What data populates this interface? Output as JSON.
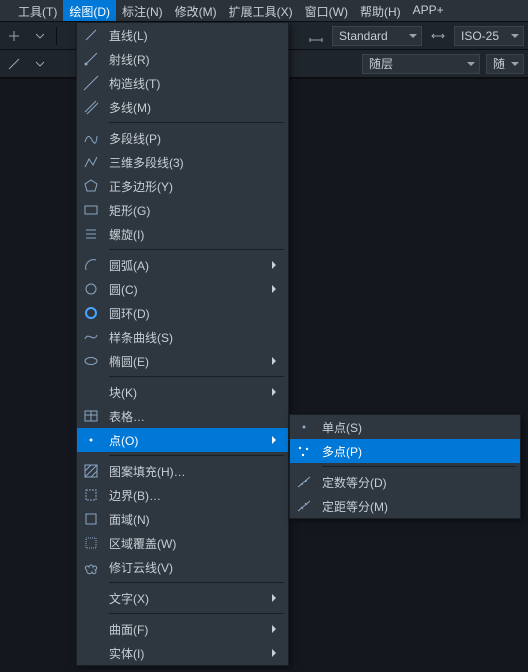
{
  "menubar": {
    "items": [
      {
        "label": "工具(T)"
      },
      {
        "label": "绘图(D)"
      },
      {
        "label": "标注(N)"
      },
      {
        "label": "修改(M)"
      },
      {
        "label": "扩展工具(X)"
      },
      {
        "label": "窗口(W)"
      },
      {
        "label": "帮助(H)"
      },
      {
        "label": "APP+"
      }
    ]
  },
  "toolbars": {
    "style_dd": "Standard",
    "dim_dd": "ISO-25",
    "layer_dd1": "随层",
    "layer_dd2": "随"
  },
  "draw_menu": {
    "items": [
      {
        "icon": "line",
        "label": "直线(L)"
      },
      {
        "icon": "ray",
        "label": "射线(R)"
      },
      {
        "icon": "construction-line",
        "label": "构造线(T)"
      },
      {
        "icon": "multiline",
        "label": "多线(M)"
      },
      {
        "sep": true
      },
      {
        "icon": "polyline",
        "label": "多段线(P)"
      },
      {
        "icon": "poly3d",
        "label": "三维多段线(3)"
      },
      {
        "icon": "polygon",
        "label": "正多边形(Y)"
      },
      {
        "icon": "rectangle",
        "label": "矩形(G)"
      },
      {
        "icon": "helix",
        "label": "螺旋(I)"
      },
      {
        "sep": true
      },
      {
        "icon": "arc",
        "label": "圆弧(A)",
        "submenu": true
      },
      {
        "icon": "circle",
        "label": "圆(C)",
        "submenu": true
      },
      {
        "icon": "donut",
        "label": "圆环(D)"
      },
      {
        "icon": "spline",
        "label": "样条曲线(S)"
      },
      {
        "icon": "ellipse",
        "label": "椭圆(E)",
        "submenu": true
      },
      {
        "sep": true
      },
      {
        "icon": "",
        "label": "块(K)",
        "submenu": true
      },
      {
        "icon": "table",
        "label": "表格…"
      },
      {
        "icon": "point",
        "label": "点(O)",
        "submenu": true,
        "highlight": true
      },
      {
        "sep": true
      },
      {
        "icon": "hatch",
        "label": "图案填充(H)…"
      },
      {
        "icon": "boundary",
        "label": "边界(B)…"
      },
      {
        "icon": "region",
        "label": "面域(N)"
      },
      {
        "icon": "wipeout",
        "label": "区域覆盖(W)"
      },
      {
        "icon": "revcloud",
        "label": "修订云线(V)"
      },
      {
        "sep": true
      },
      {
        "icon": "",
        "label": "文字(X)",
        "submenu": true
      },
      {
        "sep": true
      },
      {
        "icon": "",
        "label": "曲面(F)",
        "submenu": true
      },
      {
        "icon": "",
        "label": "实体(I)",
        "submenu": true
      }
    ]
  },
  "point_submenu": {
    "items": [
      {
        "icon": "point-single",
        "label": "单点(S)"
      },
      {
        "icon": "point-multi",
        "label": "多点(P)",
        "highlight": true
      },
      {
        "sep": true
      },
      {
        "icon": "divide",
        "label": "定数等分(D)"
      },
      {
        "icon": "measure",
        "label": "定距等分(M)"
      }
    ]
  }
}
